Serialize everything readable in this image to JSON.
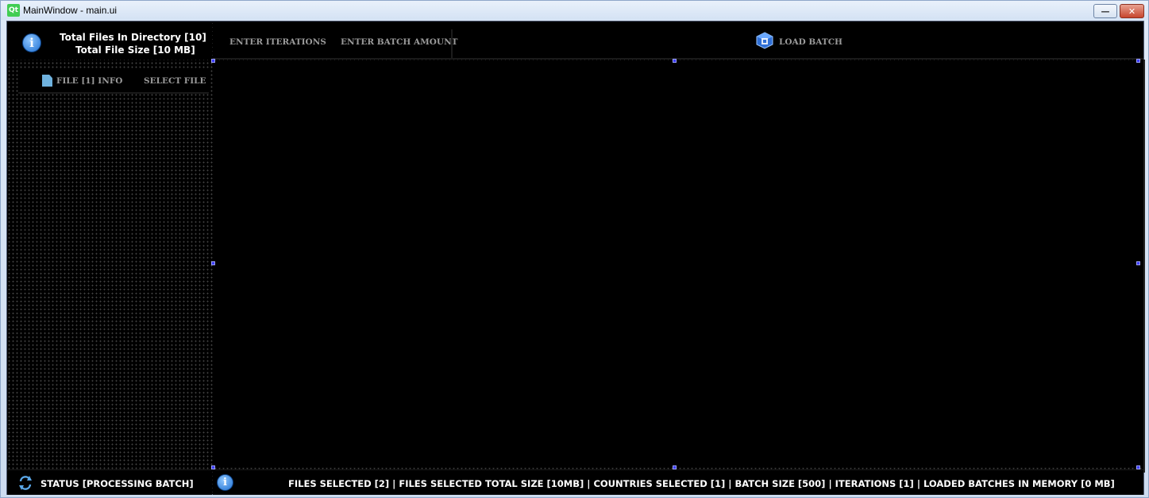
{
  "window": {
    "title": "MainWindow - main.ui",
    "app_icon": "qt-logo",
    "controls": [
      "minimize",
      "close"
    ]
  },
  "directory_info": {
    "total_files": "Total Files In Directory [10]",
    "total_size": "Total File Size [10 MB]",
    "icon": "info-icon"
  },
  "toolbar": {
    "iterations_label": "ENTER ITERATIONS",
    "batch_amount_label": "ENTER BATCH AMOUNT",
    "load_batch_label": "LOAD BATCH",
    "load_batch_icon": "cube-icon"
  },
  "file_panel": {
    "file_info_tab": "FILE [1] INFO",
    "select_file_tab": "SELECT FILE",
    "file_icon": "file-icon"
  },
  "status": {
    "text": "STATUS [PROCESSING BATCH]",
    "icon": "refresh-icon"
  },
  "summary": {
    "text": "FILES SELECTED [2] | FILES SELECTED TOTAL SIZE [10MB] | COUNTRIES SELECTED [1] | BATCH SIZE [500] | ITERATIONS [1] | LOADED BATCHES IN MEMORY [0 MB]",
    "icon": "info-icon"
  },
  "colors": {
    "background": "#000000",
    "text_primary": "#ffffff",
    "text_muted": "#9a9a9a",
    "accent": "#3b3bff",
    "file_icon": "#6fb2de"
  }
}
